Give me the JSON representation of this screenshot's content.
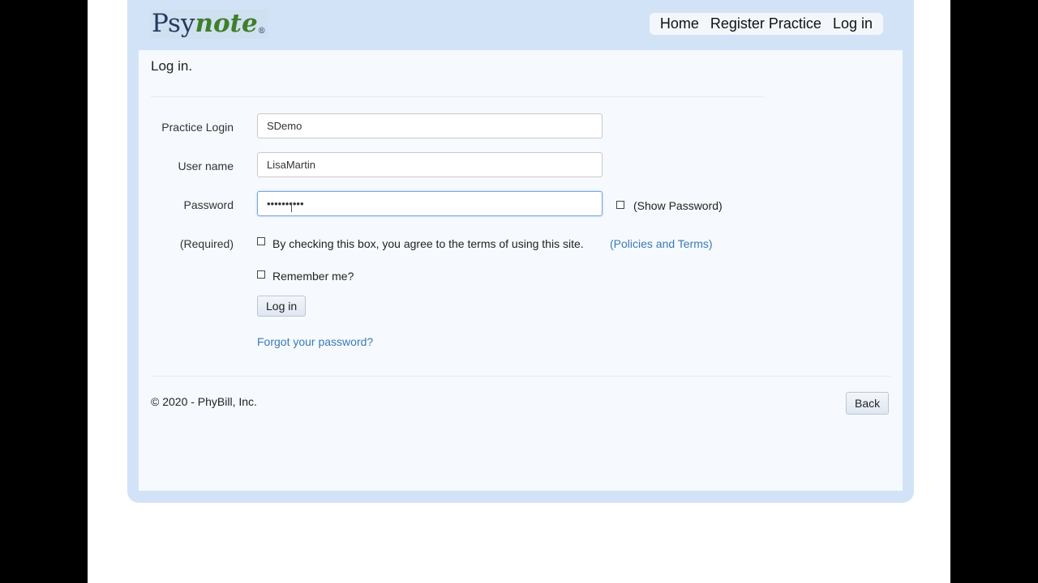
{
  "brand": {
    "logo_part1": "Psy",
    "logo_part2": "note",
    "logo_reg": "®"
  },
  "nav": {
    "items": [
      "Home",
      "Register Practice",
      "Log in"
    ]
  },
  "page": {
    "title": "Log in."
  },
  "form": {
    "practice_login": {
      "label": "Practice Login",
      "value": "SDemo"
    },
    "user_name": {
      "label": "User name",
      "value": "LisaMartin"
    },
    "password": {
      "label": "Password",
      "value": "••••••••••"
    },
    "show_password_label": "(Show Password)",
    "required_label": "(Required)",
    "terms_text": "By checking this box, you agree to the terms of using this site.",
    "policies_link": "(Policies and Terms)",
    "remember_label": "Remember me?",
    "login_button": "Log in",
    "forgot_link": "Forgot your password?"
  },
  "footer": {
    "copyright": "© 2020 - PhyBill, Inc.",
    "back_button": "Back"
  }
}
